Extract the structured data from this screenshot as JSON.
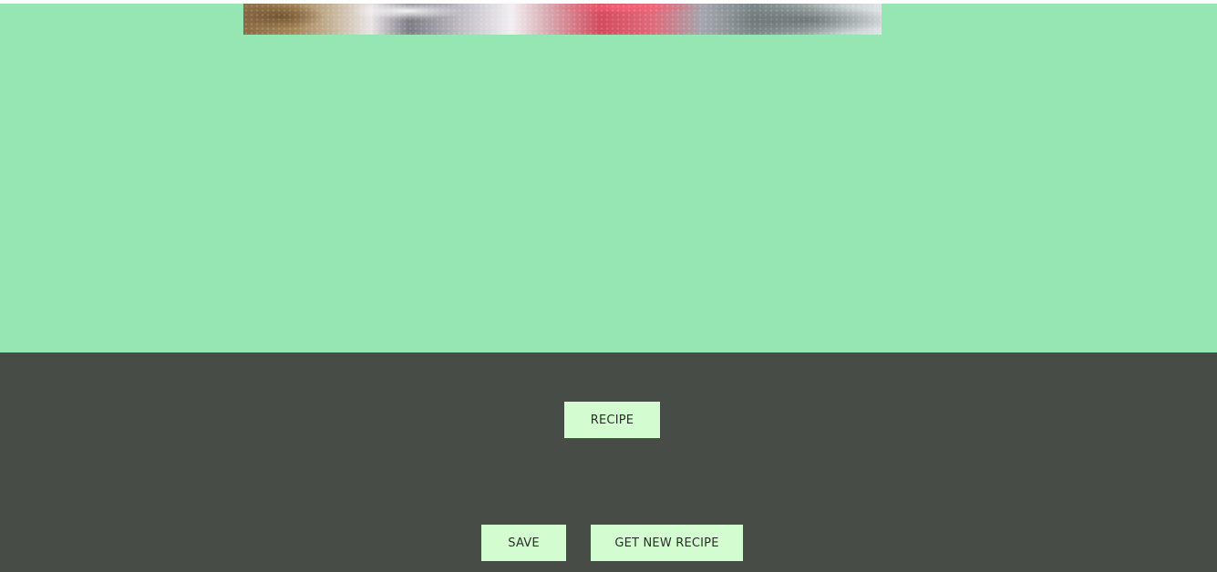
{
  "hero": {
    "image_alt": "food photo",
    "background_color": "#96e6b3"
  },
  "footer": {
    "background_color": "#474c47",
    "recipe_label": "RECIPE",
    "save_label": "SAVE",
    "new_recipe_label": "GET NEW RECIPE",
    "button_color": "#d4fcd1"
  }
}
